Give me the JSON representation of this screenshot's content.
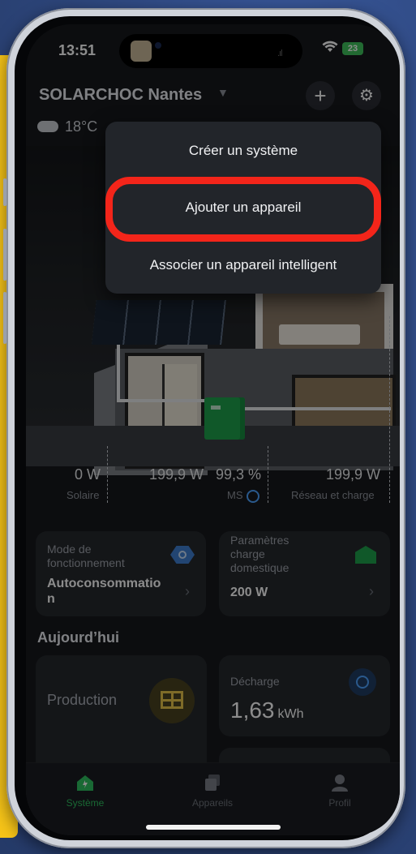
{
  "status_bar": {
    "time": "13:51",
    "signal": ".ıl",
    "battery": "23"
  },
  "header": {
    "title": "SOLARCHOC Nantes",
    "add_icon": "plus-icon",
    "settings_icon": "gear-icon"
  },
  "weather": {
    "temp": "18°C",
    "icon": "cloud-icon"
  },
  "dropdown_menu": {
    "items": [
      {
        "label": "Créer un système"
      },
      {
        "label": "Ajouter un appareil",
        "highlighted": true,
        "highlight_color": "#f3251a"
      },
      {
        "label": "Associer un appareil intelligent"
      }
    ]
  },
  "energy_flow": {
    "solar": {
      "value": "0 W",
      "label": "Solaire"
    },
    "battery": {
      "value": "199,9 W",
      "soc": "99,3 %",
      "label": "MS"
    },
    "grid": {
      "value": "199,9 W",
      "label": "Réseau et charge"
    }
  },
  "cards": {
    "mode": {
      "title": "Mode de fonctionnement",
      "value": "Autoconsommation",
      "chevron": "›"
    },
    "home_charge": {
      "title": "Paramètres charge domestique",
      "value": "200 W",
      "chevron": "›"
    }
  },
  "today": {
    "title": "Aujourd’hui",
    "production": {
      "label": "Production"
    },
    "discharge": {
      "label": "Décharge",
      "value": "1,63",
      "unit": "kWh"
    }
  },
  "tabbar": {
    "tabs": [
      {
        "label": "Système",
        "active": true
      },
      {
        "label": "Appareils",
        "active": false
      },
      {
        "label": "Profil",
        "active": false
      }
    ]
  },
  "colors": {
    "accent_green": "#2fbf5f",
    "accent_blue": "#4da3ff",
    "highlight_red": "#f3251a",
    "background": "#17191d"
  }
}
